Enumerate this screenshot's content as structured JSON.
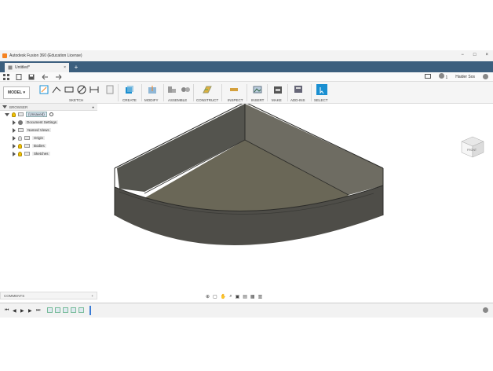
{
  "app": {
    "title": "Autodesk Fusion 360 (Education License)"
  },
  "window_controls": {
    "minimize": "−",
    "maximize": "□",
    "close": "×"
  },
  "tabs": [
    {
      "label": "Untitled*",
      "close": "×"
    }
  ],
  "new_tab": "+",
  "qat_right": {
    "job_status": "1",
    "user": "Haider Sos"
  },
  "toolbar": {
    "mode": "MODEL",
    "groups": [
      "SKETCH",
      "CREATE",
      "MODIFY",
      "ASSEMBLE",
      "CONSTRUCT",
      "INSPECT",
      "INSERT",
      "MAKE",
      "ADD-INS",
      "SELECT"
    ]
  },
  "browser": {
    "title": "BROWSER",
    "root": "(Unsaved)",
    "items": [
      "Document Settings",
      "Named Views",
      "Origin",
      "Bodies",
      "Sketches"
    ]
  },
  "comments": {
    "title": "COMMENTS",
    "add": "+"
  },
  "viewcube": {
    "face": "FRONT"
  },
  "colors": {
    "titlebar": "#3c5f7e",
    "accent": "#1a8fd1",
    "model_top": "#5e5c52",
    "model_side": "#4a4a45"
  },
  "icons": [
    "app-logo-icon",
    "data-panel-icon",
    "file-icon",
    "save-icon",
    "undo-icon",
    "redo-icon",
    "notifications-icon",
    "job-status-icon",
    "help-icon",
    "cube-icon"
  ]
}
